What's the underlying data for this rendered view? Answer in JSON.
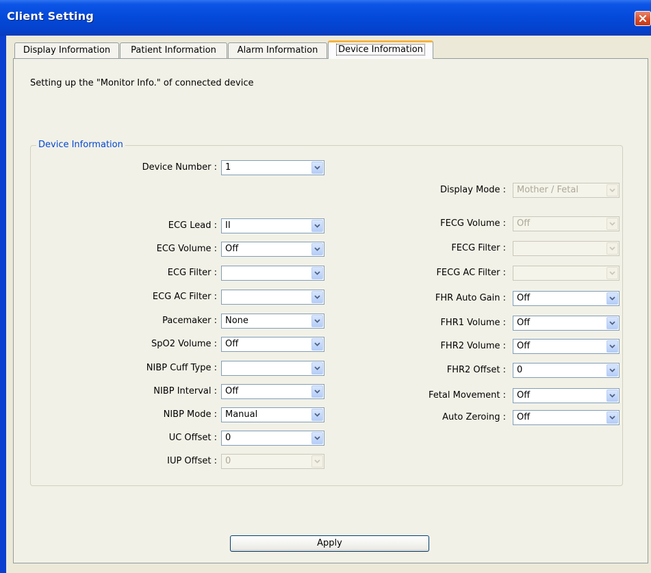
{
  "window": {
    "title": "Client Setting",
    "close_icon": "close-icon"
  },
  "tabs": [
    {
      "label": "Display Information"
    },
    {
      "label": "Patient Information"
    },
    {
      "label": "Alarm Information"
    },
    {
      "label": "Device Information",
      "active": true
    }
  ],
  "panel": {
    "description": "Setting up the \"Monitor Info.\" of connected device",
    "group_title": "Device Information"
  },
  "device_number": {
    "label": "Device Number :",
    "value": "1"
  },
  "display_mode": {
    "label": "Display Mode :",
    "value": "Mother / Fetal",
    "disabled": true
  },
  "left_fields": [
    {
      "label": "ECG Lead :",
      "value": "II"
    },
    {
      "label": "ECG Volume :",
      "value": "Off"
    },
    {
      "label": "ECG Filter :",
      "value": ""
    },
    {
      "label": "ECG AC Filter :",
      "value": ""
    },
    {
      "label": "Pacemaker :",
      "value": "None"
    },
    {
      "label": "SpO2 Volume :",
      "value": "Off"
    },
    {
      "label": "NIBP Cuff Type :",
      "value": ""
    },
    {
      "label": "NIBP Interval :",
      "value": "Off"
    },
    {
      "label": "NIBP Mode :",
      "value": "Manual"
    },
    {
      "label": "UC Offset :",
      "value": "0"
    },
    {
      "label": "IUP Offset :",
      "value": "0",
      "disabled": true
    }
  ],
  "right_fields": [
    {
      "label": "FECG Volume :",
      "value": "Off",
      "disabled": true
    },
    {
      "label": "FECG Filter :",
      "value": "",
      "disabled": true
    },
    {
      "label": "FECG AC Filter :",
      "value": "",
      "disabled": true
    },
    {
      "label": "FHR Auto Gain :",
      "value": "Off"
    },
    {
      "label": "FHR1 Volume :",
      "value": "Off"
    },
    {
      "label": "FHR2 Volume :",
      "value": "Off"
    },
    {
      "label": "FHR2 Offset :",
      "value": "0"
    },
    {
      "label": "Fetal Movement :",
      "value": "Off"
    },
    {
      "label": "Auto Zeroing :",
      "value": "Off"
    }
  ],
  "apply_button": {
    "label": "Apply"
  },
  "colors": {
    "title_bar": "#0449d9",
    "accent": "#0046d5",
    "tab_highlight": "#f8b33a",
    "face": "#ece9d8"
  }
}
